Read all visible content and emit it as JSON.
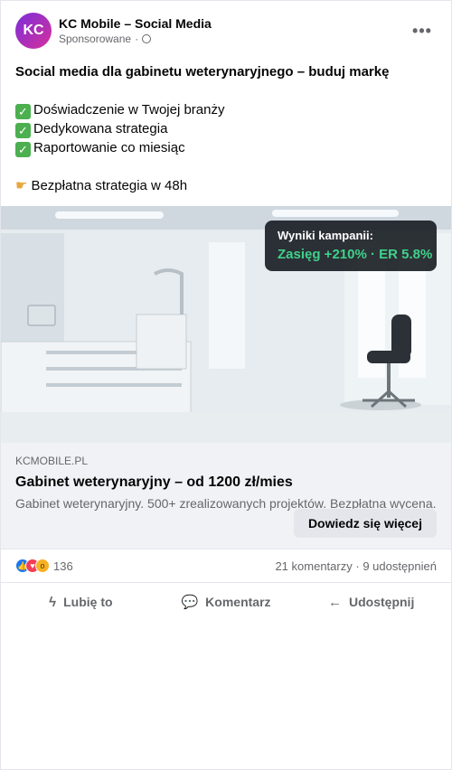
{
  "header": {
    "avatar_initials": "KC",
    "page_name": "KC Mobile – Social Media",
    "sponsored_label": "Sponsorowane",
    "separator": "·",
    "more_label": "•••"
  },
  "post": {
    "headline": "Social media dla gabinetu weterynaryjnego – buduj markę",
    "checks": [
      "Doświadczenie w Twojej branży",
      "Dedykowana strategia",
      "Raportowanie co miesiąc"
    ],
    "offer": "Bezpłatna strategia w 48h"
  },
  "media": {
    "badge_title": "Wyniki kampanii:",
    "badge_value": "Zasięg +210% · ER 5.8%"
  },
  "link": {
    "domain": "KCMOBILE.PL",
    "title": "Gabinet weterynaryjny – od 1200 zł/mies",
    "description": "Gabinet weterynaryjny. 500+ zrealizowanych projektów. Bezpłatna wycena.",
    "cta_label": "Dowiedz się więcej"
  },
  "stats": {
    "reaction_count": "136",
    "comments": "21 komentarzy",
    "separator": "·",
    "shares": "9 udostępnień"
  },
  "actions": {
    "like_label": "Lubię to",
    "comment_label": "Komentarz",
    "share_label": "Udostępnij"
  },
  "colors": {
    "accent": "#1877f2",
    "badge_value": "#3fd18a",
    "text_secondary": "#65676b"
  }
}
